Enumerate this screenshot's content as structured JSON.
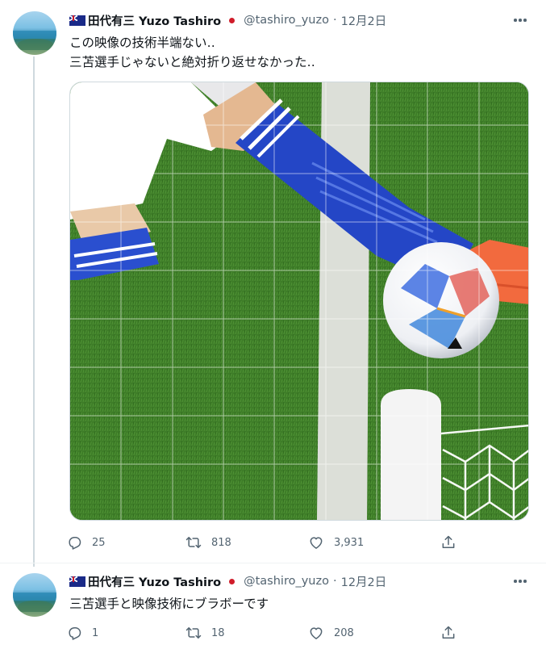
{
  "tweets": [
    {
      "name": "田代有三 Yuzo Tashiro",
      "handle": "@tashiro_yuzo",
      "separator": "·",
      "date": "12月2日",
      "lines": [
        "この映像の技術半端ない‥",
        "三苫選手じゃないと絶対折り返せなかった‥"
      ],
      "replies": "25",
      "retweets": "818",
      "likes": "3,931"
    },
    {
      "name": "田代有三 Yuzo Tashiro",
      "handle": "@tashiro_yuzo",
      "separator": "·",
      "date": "12月2日",
      "lines": [
        "三苫選手と映像技術にブラボーです"
      ],
      "replies": "1",
      "retweets": "18",
      "likes": "208"
    }
  ],
  "icons": {
    "reply": "reply-icon",
    "retweet": "retweet-icon",
    "like": "heart-icon",
    "share": "share-icon",
    "more": "more-icon",
    "flag_au": "australia-flag-icon",
    "flag_jp": "japan-flag-icon"
  },
  "colors": {
    "muted": "#536471",
    "grass": "#3b7a26",
    "sock_blue": "#2446c6",
    "boot": "#f26a3e"
  }
}
